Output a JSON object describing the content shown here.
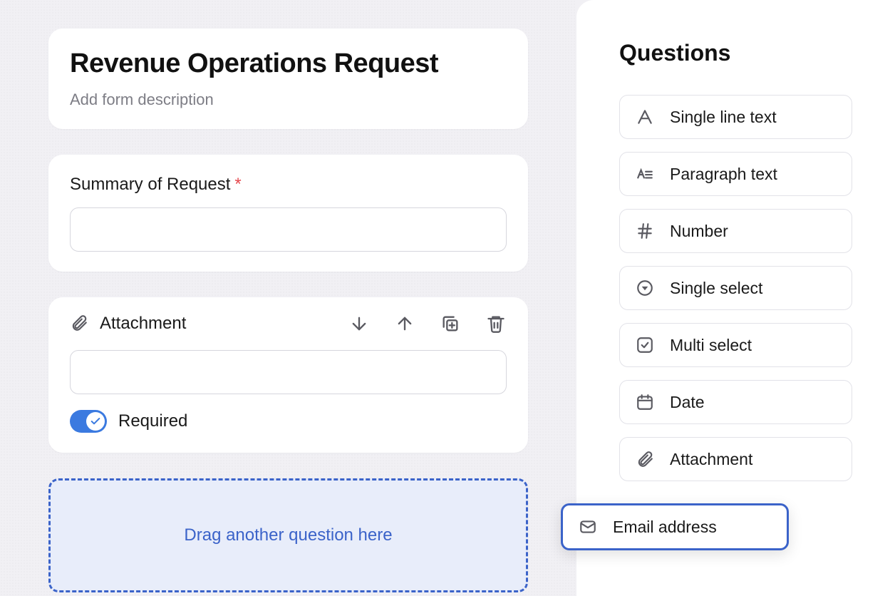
{
  "form": {
    "title": "Revenue Operations Request",
    "description_placeholder": "Add form description"
  },
  "summary_block": {
    "label": "Summary of Request",
    "required_marker": "*",
    "value": ""
  },
  "attachment_block": {
    "label": "Attachment",
    "value": "",
    "required_toggle_label": "Required",
    "required": true
  },
  "dropzone": {
    "prompt": "Drag another question here"
  },
  "sidebar": {
    "title": "Questions",
    "types": [
      {
        "key": "single_line",
        "label": "Single line text"
      },
      {
        "key": "paragraph",
        "label": "Paragraph text"
      },
      {
        "key": "number",
        "label": "Number"
      },
      {
        "key": "single_sel",
        "label": "Single select"
      },
      {
        "key": "multi_sel",
        "label": "Multi select"
      },
      {
        "key": "date",
        "label": "Date"
      },
      {
        "key": "attachment",
        "label": "Attachment"
      }
    ],
    "dragged": {
      "key": "email",
      "label": "Email address"
    }
  }
}
